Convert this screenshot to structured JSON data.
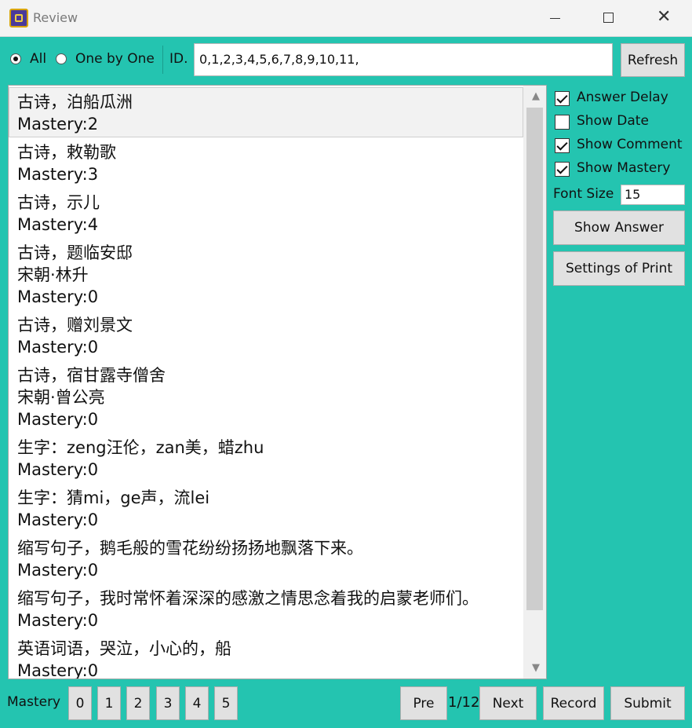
{
  "window": {
    "title": "Review"
  },
  "toolbar": {
    "mode_all": "All",
    "mode_one": "One by One",
    "id_label": "ID.",
    "id_value": "0,1,2,3,4,5,6,7,8,9,10,11,",
    "refresh": "Refresh"
  },
  "items": [
    {
      "lines": [
        "古诗，泊船瓜洲",
        "Mastery:2"
      ]
    },
    {
      "lines": [
        "古诗，敕勒歌",
        "Mastery:3"
      ]
    },
    {
      "lines": [
        "古诗，示儿",
        "Mastery:4"
      ]
    },
    {
      "lines": [
        "古诗，题临安邸",
        "宋朝·林升",
        "Mastery:0"
      ]
    },
    {
      "lines": [
        "古诗，赠刘景文",
        "Mastery:0"
      ]
    },
    {
      "lines": [
        "古诗，宿甘露寺僧舍",
        "宋朝·曾公亮",
        "Mastery:0"
      ]
    },
    {
      "lines": [
        "生字：zeng汪伦，zan美，蜡zhu",
        "Mastery:0"
      ]
    },
    {
      "lines": [
        "生字：猜mi，ge声，流lei",
        "Mastery:0"
      ]
    },
    {
      "lines": [
        "缩写句子，鹅毛般的雪花纷纷扬扬地飘落下来。",
        "Mastery:0"
      ]
    },
    {
      "lines": [
        "缩写句子，我时常怀着深深的感激之情思念着我的启蒙老师们。",
        "Mastery:0"
      ]
    },
    {
      "lines": [
        "英语词语，哭泣，小心的，船",
        "Mastery:0"
      ]
    }
  ],
  "options": {
    "answer_delay": "Answer Delay",
    "show_date": "Show Date",
    "show_comment": "Show Comment",
    "show_mastery": "Show Mastery",
    "font_size_label": "Font Size",
    "font_size_value": "15",
    "show_answer": "Show Answer",
    "settings_print": "Settings of Print"
  },
  "bottom": {
    "mastery_label": "Mastery",
    "levels": [
      "0",
      "1",
      "2",
      "3",
      "4",
      "5"
    ],
    "pre": "Pre",
    "page": "1/12",
    "next": "Next",
    "record": "Record",
    "submit": "Submit"
  }
}
